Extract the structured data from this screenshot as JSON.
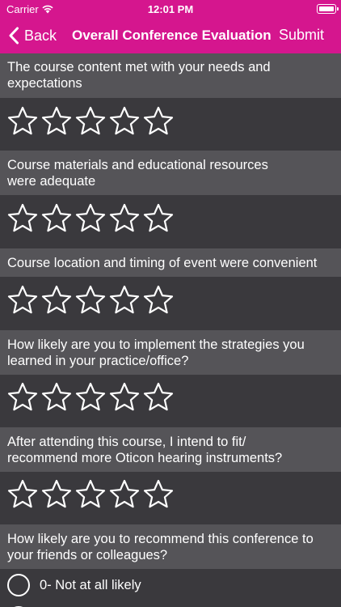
{
  "status": {
    "carrier": "Carrier",
    "time": "12:01 PM"
  },
  "nav": {
    "back": "Back",
    "title": "Overall Conference Evaluation",
    "submit": "Submit"
  },
  "questions": [
    {
      "line1": "The course content met with your needs and",
      "line2": "expectations",
      "rating": 0,
      "max": 5
    },
    {
      "line1": "Course materials and educational resources",
      "line2": "were adequate",
      "rating": 0,
      "max": 5
    },
    {
      "line1": "Course location and timing of event were convenient",
      "rating": 0,
      "max": 5
    },
    {
      "line1": "How likely are you to implement the strategies you",
      "line2": "learned in your practice/office?",
      "rating": 0,
      "max": 5
    },
    {
      "line1": "After attending this course, I intend to fit/",
      "line2": "recommend more Oticon hearing instruments?",
      "rating": 0,
      "max": 5
    },
    {
      "line1": "How likely are you to recommend this conference to",
      "line2": "your friends or colleagues?"
    }
  ],
  "options": [
    {
      "label": "0- Not at all likely",
      "selected": false
    }
  ],
  "colors": {
    "accent": "#d5168e",
    "header_row": "#555458",
    "background": "#3a393d"
  }
}
